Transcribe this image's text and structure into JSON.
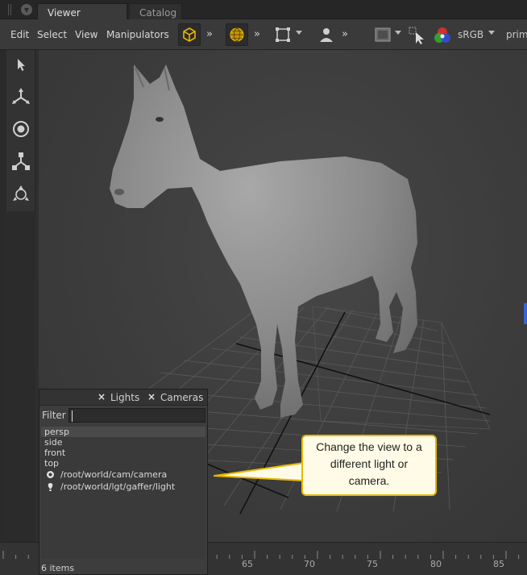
{
  "tabs": [
    {
      "label": "Viewer",
      "active": true
    },
    {
      "label": "Catalog",
      "active": false
    }
  ],
  "menu": [
    "Edit",
    "Select",
    "View",
    "Manipulators"
  ],
  "toolbar": {
    "more_glyph": "»",
    "colorspace": "sRGB",
    "truncated_label": "prim",
    "icons": [
      "cube-icon",
      "globe-icon",
      "frame-icon",
      "person-icon",
      "display-icon",
      "select-arrow-icon",
      "rgb-icon"
    ]
  },
  "tools": [
    "select-arrow-icon",
    "translate-icon",
    "rotate-icon",
    "scale-icon",
    "transform-icon"
  ],
  "panel": {
    "tabs": [
      "Lights",
      "Cameras"
    ],
    "close_glyph": "×",
    "filter_label": "Filter",
    "filter_value": "",
    "items": [
      {
        "label": "persp",
        "selected": true,
        "icon": ""
      },
      {
        "label": "side",
        "selected": false,
        "icon": ""
      },
      {
        "label": "front",
        "selected": false,
        "icon": ""
      },
      {
        "label": "top",
        "selected": false,
        "icon": ""
      },
      {
        "label": "/root/world/cam/camera",
        "selected": false,
        "icon": "camera-icon"
      },
      {
        "label": "/root/world/lgt/gaffer/light",
        "selected": false,
        "icon": "light-icon"
      }
    ],
    "count_label": "6 items"
  },
  "callout": {
    "line1": "Change the view to a",
    "line2": "different light or",
    "line3": "camera."
  },
  "timeline": {
    "ticks": [
      "65",
      "70",
      "75",
      "80",
      "85"
    ]
  },
  "colors": {
    "accent": "#e6b800",
    "callout_bg": "#fffbe6",
    "gizmo_blue": "#3b63d6"
  }
}
